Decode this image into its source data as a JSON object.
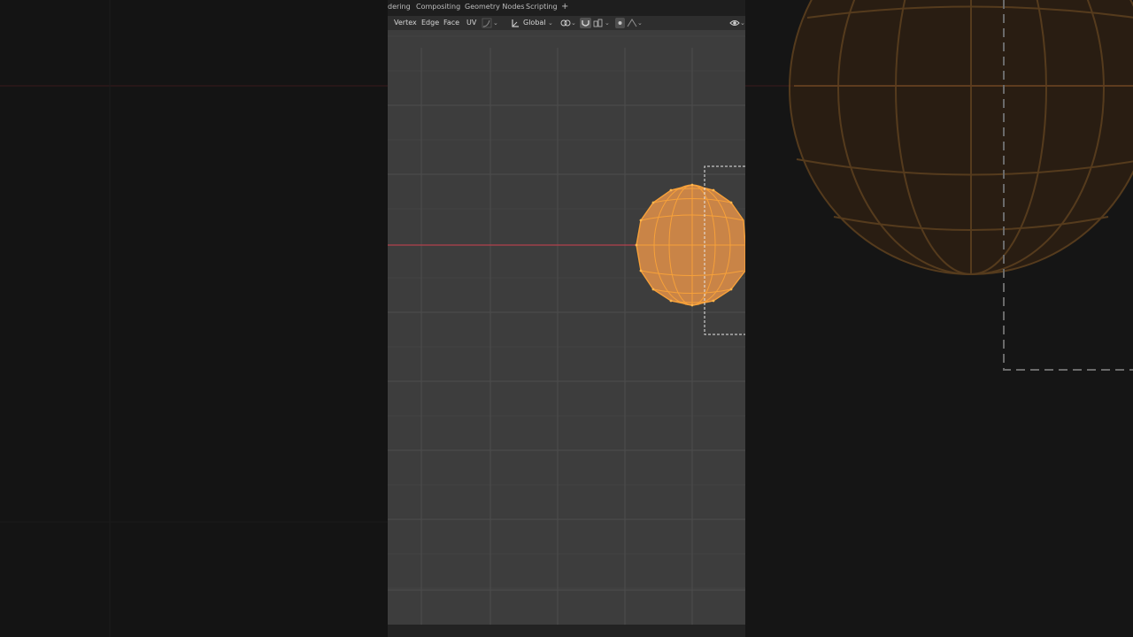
{
  "workspace_tabs": [
    {
      "label": "dering",
      "name": "tab-rendering"
    },
    {
      "label": "Compositing",
      "name": "tab-compositing"
    },
    {
      "label": "Geometry Nodes",
      "name": "tab-geometry-nodes"
    },
    {
      "label": "Scripting",
      "name": "tab-scripting"
    }
  ],
  "add_workspace": "+",
  "header": {
    "vertex": "Vertex",
    "edge": "Edge",
    "face": "Face",
    "uv": "UV",
    "orientation": "Global"
  },
  "icons": {
    "transform_pivot": "pivot-icon",
    "snap": "snap-icon",
    "proportional": "proportional-edit-icon",
    "falloff": "falloff-icon",
    "visibility": "eye-icon",
    "link": "link-icon",
    "magnet": "magnet-icon"
  },
  "colors": {
    "mesh_edge": "#f7a13a",
    "mesh_fill": "#d8894a",
    "x_axis": "#b3414b",
    "grid": "#4a4a4a",
    "viewport_bg": "#3d3d3d"
  }
}
